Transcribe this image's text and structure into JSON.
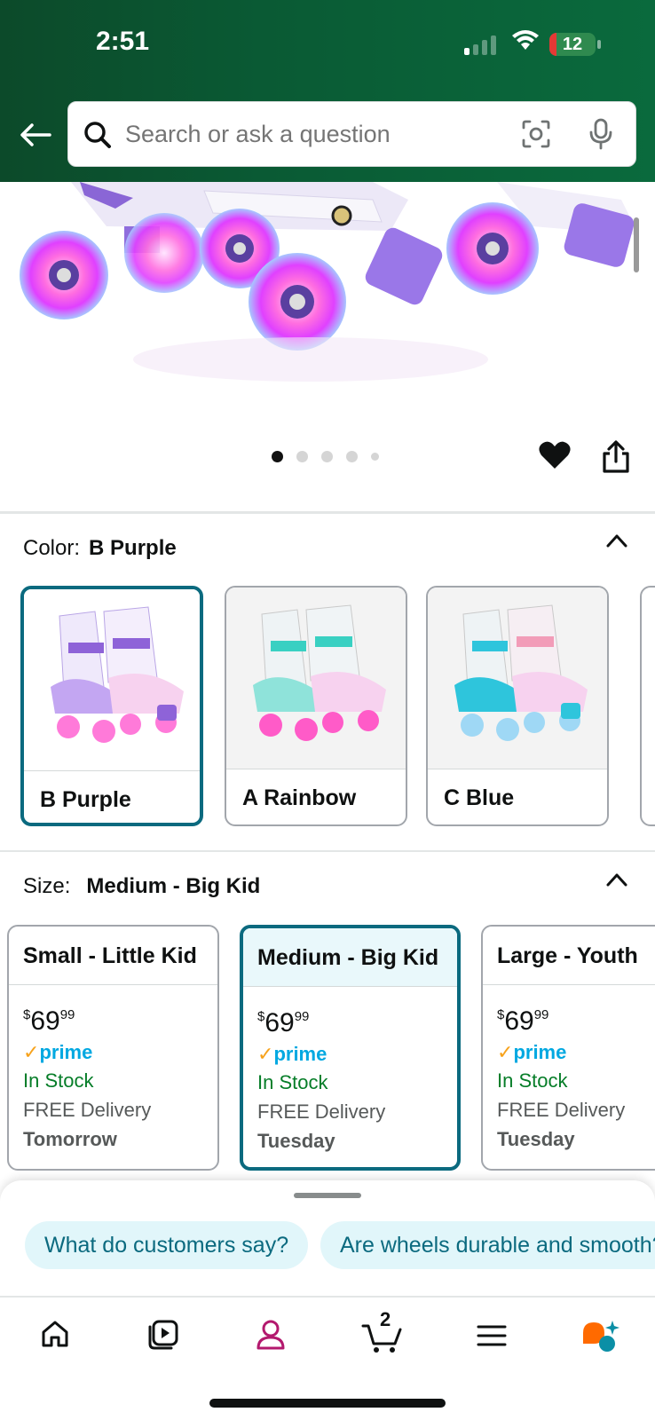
{
  "status_bar": {
    "time": "2:51",
    "battery": "12"
  },
  "search": {
    "placeholder": "Search or ask a question"
  },
  "gallery": {
    "dot_count": 5,
    "active_index": 0
  },
  "color": {
    "label": "Color:",
    "selected": "B Purple",
    "options": [
      {
        "name": "B Purple",
        "accent": "#9b6fe0"
      },
      {
        "name": "A Rainbow",
        "accent": "#39d0c2"
      },
      {
        "name": "C Blue",
        "accent": "#2ec5dc"
      }
    ]
  },
  "size": {
    "label": "Size:",
    "selected": "Medium - Big Kid",
    "options": [
      {
        "title": "Small - Little Kid",
        "price_symbol": "$",
        "price_whole": "69",
        "price_frac": "99",
        "prime": "prime",
        "stock": "In Stock",
        "delivery": "FREE Delivery",
        "day": "Tomorrow"
      },
      {
        "title": "Medium - Big Kid",
        "price_symbol": "$",
        "price_whole": "69",
        "price_frac": "99",
        "prime": "prime",
        "stock": "In Stock",
        "delivery": "FREE Delivery",
        "day": "Tuesday"
      },
      {
        "title": "Large - Youth",
        "price_symbol": "$",
        "price_whole": "69",
        "price_frac": "99",
        "prime": "prime",
        "stock": "In Stock",
        "delivery": "FREE Delivery",
        "day": "Tuesday"
      }
    ]
  },
  "questions": [
    "What do customers say?",
    "Are wheels durable and smooth?"
  ],
  "tabbar": {
    "cart_count": "2",
    "icons": [
      "home-icon",
      "video-icon",
      "account-icon",
      "cart-icon",
      "menu-icon",
      "rufus-icon"
    ]
  },
  "colors": {
    "header_green": "#0a5a34",
    "selection_teal": "#0b6a7f",
    "in_stock_green": "#067d28",
    "prime_blue": "#00a8e1",
    "account_pink": "#b3196e"
  }
}
